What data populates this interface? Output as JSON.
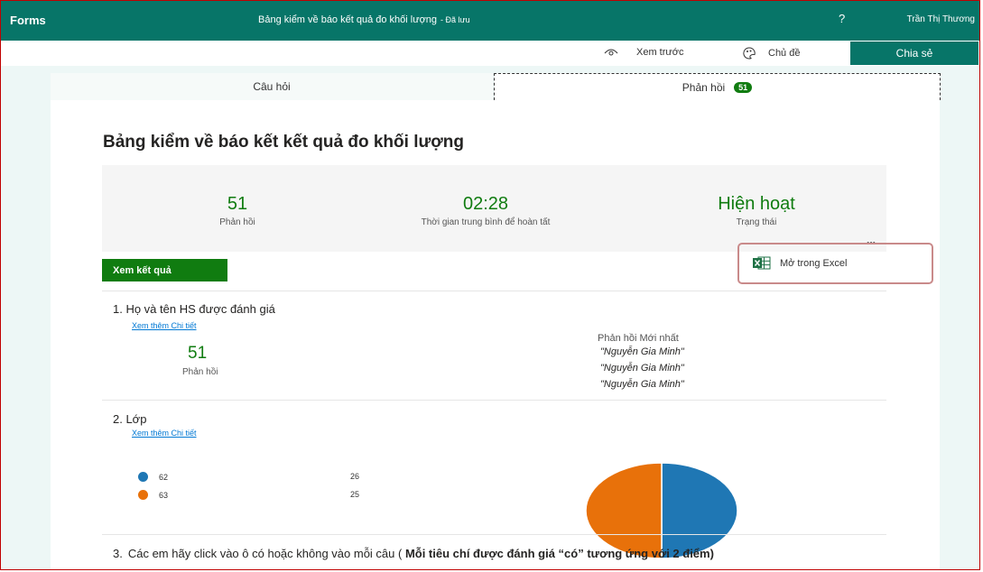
{
  "header": {
    "brand": "Forms",
    "title": "Bảng kiểm về báo kết quả đo khối lượng",
    "saved": "- Đã lưu",
    "help": "?",
    "user": "Trần Thị Thương"
  },
  "toolbar": {
    "preview_label": "Xem trước",
    "theme_label": "Chủ đề",
    "share_label": "Chia sẻ"
  },
  "tabs": {
    "questions": "Câu hỏi",
    "responses": "Phản hồi",
    "responses_badge": "51"
  },
  "summary": {
    "title": "Bảng kiểm về báo kết kết quả đo khối lượng",
    "responses_value": "51",
    "responses_label": "Phản hồi",
    "avg_time_value": "02:28",
    "avg_time_label": "Thời gian trung bình để hoàn tất",
    "status_value": "Hiện hoạt",
    "status_label": "Trạng thái",
    "more": "...",
    "view_results": "Xem kết quả",
    "open_excel": "Mở trong Excel"
  },
  "questions": [
    {
      "title": "1.  Họ và tên HS được đánh giá",
      "link": "Xem thêm Chi tiết",
      "count": "51",
      "count_label": "Phản hồi",
      "latest_header": "Phản hồi Mới nhất",
      "latest": [
        "\"Nguyễn Gia Minh\"",
        "\"Nguyễn Gia Minh\"",
        "\"Nguyễn Gia Minh\""
      ]
    },
    {
      "title": "2.  Lớp",
      "link": "Xem thêm Chi tiết",
      "options": [
        {
          "label": "62",
          "count": "26",
          "color": "#1f77b4"
        },
        {
          "label": "63",
          "count": "25",
          "color": "#e8710a"
        }
      ]
    },
    {
      "number": "3.",
      "text": "Các em hãy click vào ô có hoặc không vào mỗi câu ( ",
      "bold": "Mỗi tiêu chí được đánh giá “có” tương ứng với 2 điểm)"
    }
  ],
  "colors": {
    "header": "#077568",
    "accent": "#107c10",
    "workspace": "#edf7f6"
  }
}
